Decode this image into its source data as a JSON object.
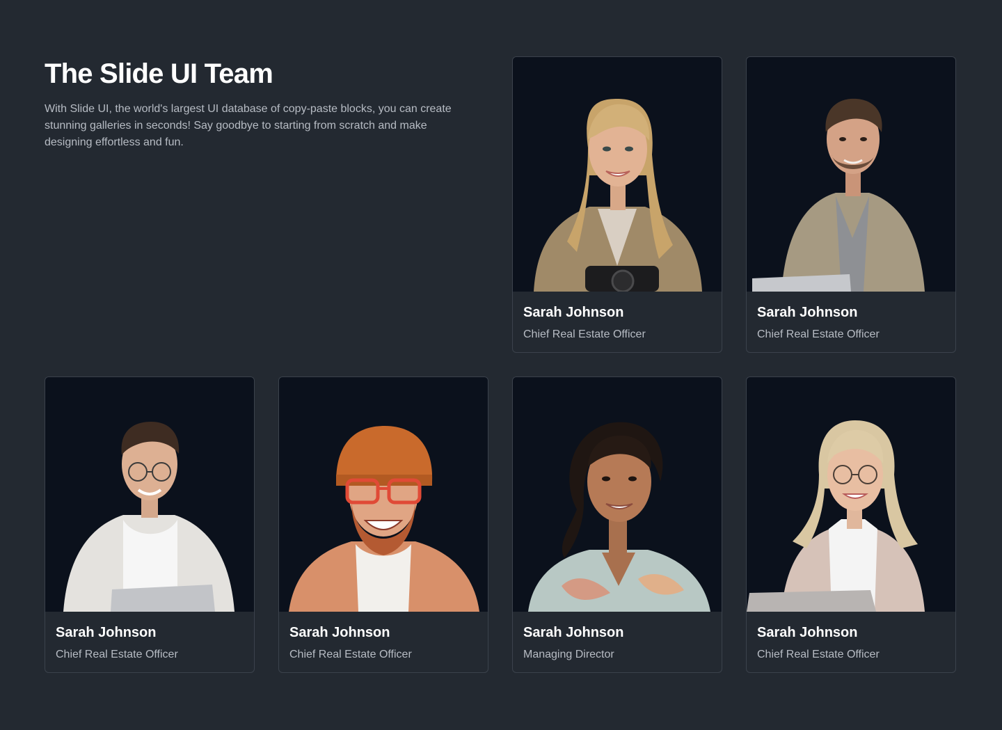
{
  "header": {
    "title": "The Slide UI Team",
    "description": "With Slide UI, the world's largest UI database of copy-paste blocks, you can create stunning galleries in seconds! Say goodbye to starting from scratch and make designing effortless and fun."
  },
  "team": [
    {
      "name": "Sarah Johnson",
      "role": "Chief Real Estate Officer",
      "photo": "woman-blonde-camera-portrait"
    },
    {
      "name": "Sarah Johnson",
      "role": "Chief Real Estate Officer",
      "photo": "man-jacket-laptop-portrait"
    },
    {
      "name": "Sarah Johnson",
      "role": "Chief Real Estate Officer",
      "photo": "man-glasses-laptop-portrait"
    },
    {
      "name": "Sarah Johnson",
      "role": "Chief Real Estate Officer",
      "photo": "man-beanie-beard-portrait"
    },
    {
      "name": "Sarah Johnson",
      "role": "Managing Director",
      "photo": "woman-curly-hair-portrait"
    },
    {
      "name": "Sarah Johnson",
      "role": "Chief Real Estate Officer",
      "photo": "woman-glasses-laptop-portrait"
    }
  ],
  "colors": {
    "background": "#232931",
    "card_border": "#3b424c",
    "photo_background": "#0b111c",
    "title": "#ffffff",
    "muted_text": "#b7bcc4"
  }
}
